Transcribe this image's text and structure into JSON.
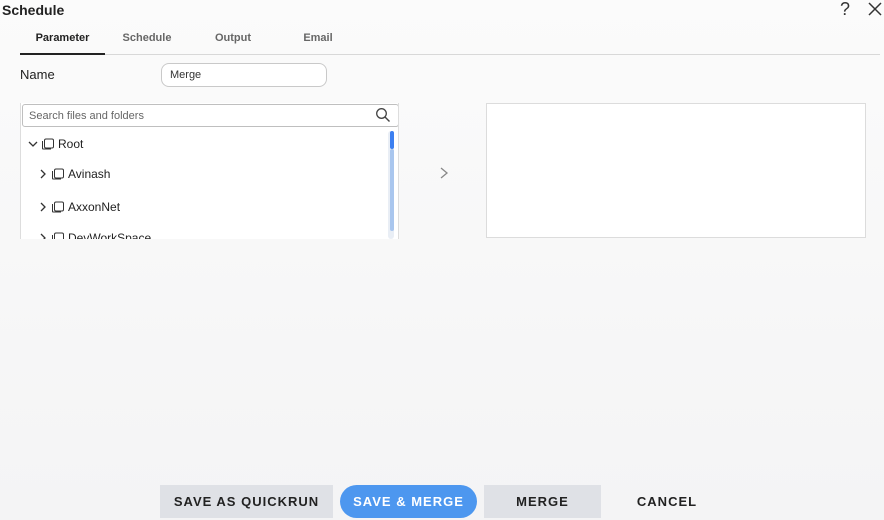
{
  "dialog": {
    "title": "Schedule",
    "help_glyph": "?",
    "icons": {
      "help": "question-mark-icon",
      "close": "close-icon"
    }
  },
  "tabs": [
    {
      "label": "Parameter",
      "active": true
    },
    {
      "label": "Schedule",
      "active": false
    },
    {
      "label": "Output",
      "active": false
    },
    {
      "label": "Email",
      "active": false
    }
  ],
  "form": {
    "name_label": "Name",
    "name_value": "Merge"
  },
  "tree": {
    "search_placeholder": "Search files and folders",
    "nodes": [
      {
        "label": "Root",
        "expanded": true,
        "level": 0
      },
      {
        "label": "Avinash",
        "expanded": false,
        "level": 1
      },
      {
        "label": "AxxonNet",
        "expanded": false,
        "level": 1
      },
      {
        "label": "DevWorkSpace",
        "expanded": false,
        "level": 1
      }
    ]
  },
  "buttons": {
    "save_quickrun": "SAVE AS QUICKRUN",
    "save_merge": "SAVE & MERGE",
    "merge": "MERGE",
    "cancel": "CANCEL"
  },
  "colors": {
    "primary": "#4d97ef",
    "secondary_button": "#dfe1e6",
    "scroll_thumb": "#a9c6ee"
  }
}
